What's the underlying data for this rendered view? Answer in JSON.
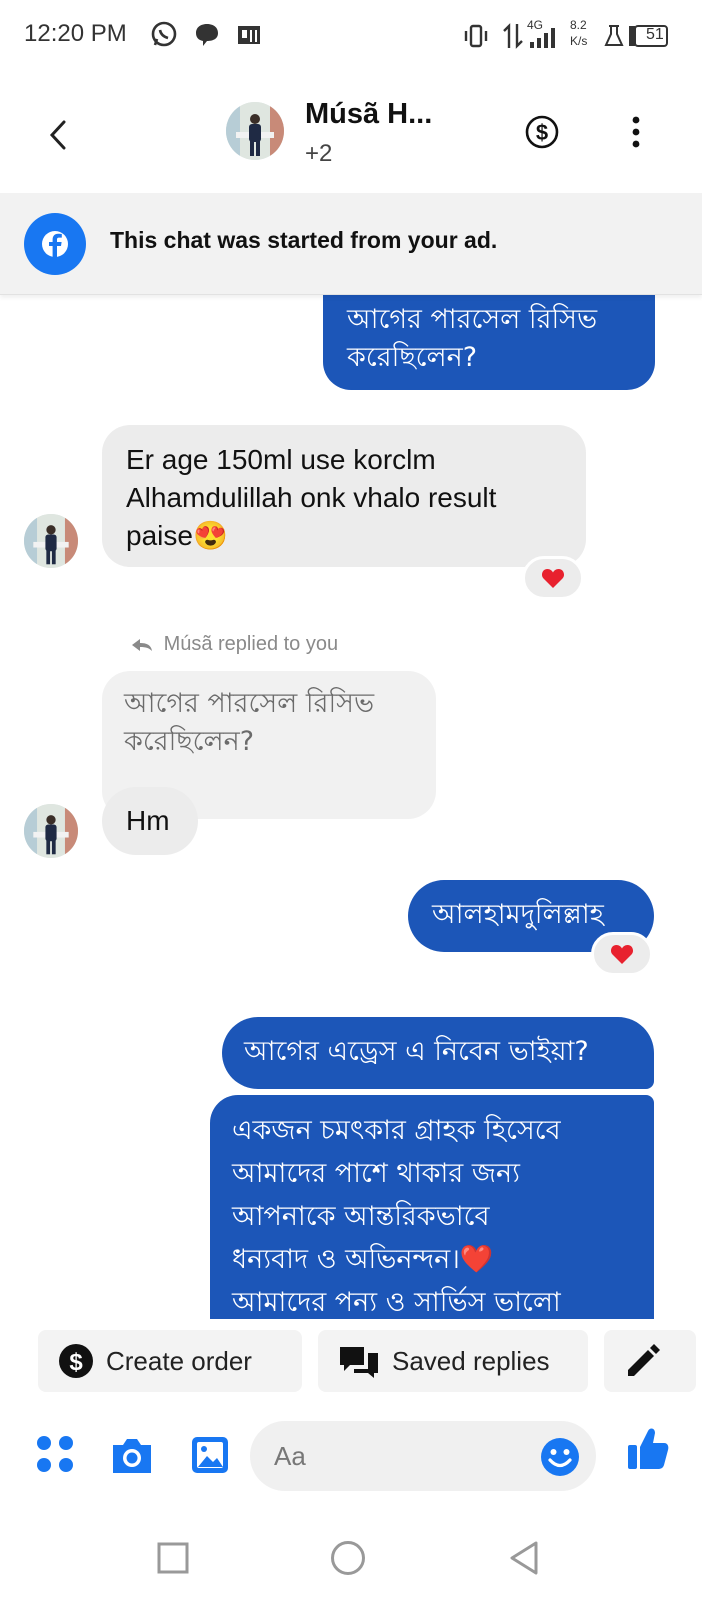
{
  "status_bar": {
    "time": "12:20 PM",
    "network": "4G",
    "speed_value": "8.2",
    "speed_unit": "K/s",
    "battery": "51",
    "icons": [
      "whatsapp-icon",
      "chat-icon",
      "pocket-icon",
      "vibrate-icon",
      "data-arrows-icon",
      "signal-icon",
      "lab-icon",
      "battery-icon"
    ]
  },
  "header": {
    "title": "Músã H...",
    "subtitle": "+2",
    "back_icon": "chevron-left-icon",
    "dollar_icon": "dollar-circle-icon",
    "more_icon": "more-vertical-icon"
  },
  "ad_banner": {
    "text": "This chat was started from your ad.",
    "icon": "facebook-icon"
  },
  "messages": [
    {
      "id": "m1",
      "direction": "outgoing",
      "lines": [
        "আগের পারসেল রিসিভ",
        "করেছিলেন?"
      ]
    },
    {
      "id": "m2",
      "direction": "incoming",
      "lines": [
        "Er age 150ml use korclm",
        "Alhamdulillah onk vhalo result",
        "paise😍"
      ],
      "reaction": "❤️"
    },
    {
      "id": "m3",
      "direction": "reply_note",
      "text": "Músã replied to you"
    },
    {
      "id": "m4",
      "direction": "incoming_quote",
      "lines": [
        "আগের পারসেল রিসিভ",
        "করেছিলেন?"
      ]
    },
    {
      "id": "m5",
      "direction": "incoming",
      "lines": [
        "Hm"
      ]
    },
    {
      "id": "m6",
      "direction": "outgoing",
      "lines": [
        "আলহামদুলিল্লাহ"
      ],
      "reaction": "❤️"
    },
    {
      "id": "m7",
      "direction": "outgoing",
      "lines": [
        "আগের এড্রেস এ নিবেন ভাইয়া?"
      ]
    },
    {
      "id": "m8",
      "direction": "outgoing",
      "lines": [
        "একজন  চমৎকার গ্রাহক হিসেবে",
        "আমাদের পাশে থাকার জন্য",
        "আপনাকে আন্তরিকভাবে",
        "ধন্যবাদ ও অভিনন্দন।❤️",
        "আমাদের পন্য ও সার্ভিস ভালো"
      ]
    }
  ],
  "quick_actions": [
    {
      "label": "Create order",
      "icon": "dollar-icon"
    },
    {
      "label": "Saved replies",
      "icon": "saved-replies-icon"
    },
    {
      "label": "",
      "icon": "pencil-icon"
    }
  ],
  "composer": {
    "placeholder": "Aa",
    "icons": [
      "apps-icon",
      "camera-icon",
      "gallery-icon",
      "emoji-icon",
      "thumbs-up-icon"
    ]
  },
  "nav_bar": {
    "icons": [
      "recents-icon",
      "home-icon",
      "back-icon"
    ]
  },
  "colors": {
    "accent": "#1877f2",
    "outgoing_bubble": "#1c56b8",
    "incoming_bubble": "#ececec",
    "heart": "#e8212e"
  }
}
